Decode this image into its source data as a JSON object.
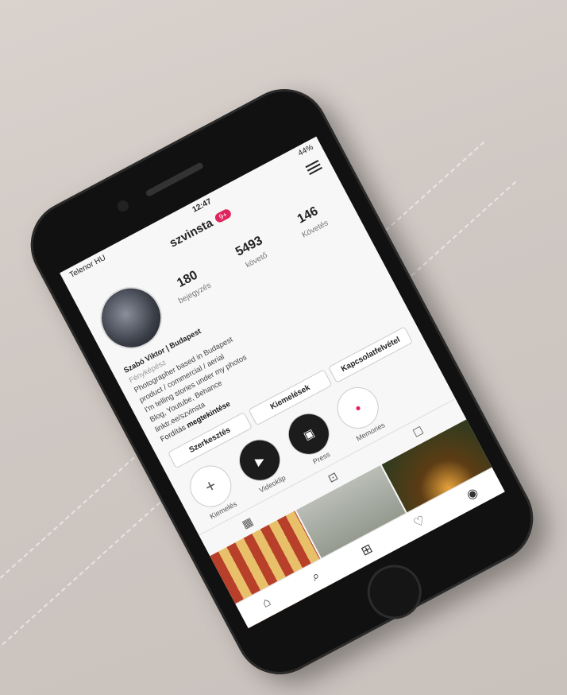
{
  "status": {
    "carrier": "Telenor HU",
    "time": "12:47",
    "battery": "44%"
  },
  "header": {
    "username": "szvinsta",
    "notif_badge": "9+"
  },
  "stats": [
    {
      "number": "180",
      "label": "bejegyzés"
    },
    {
      "number": "5493",
      "label": "követő"
    },
    {
      "number": "146",
      "label": "Követés"
    }
  ],
  "bio": {
    "name": "Szabó Viktor | Budapest",
    "category": "Fényképész",
    "line1": "Photographer based in Budapest",
    "line2": "product / commercial / aerial",
    "line3": "I'm telling stories under my photos",
    "line4": "Blog, Youtube, Behance",
    "line5": "linktr.ee/szvinsta",
    "link_prefix": "Fordítás",
    "link_bold": "megtekintése"
  },
  "actions": {
    "edit": "Szerkesztés",
    "promote": "Kiemelések",
    "contact": "Kapcsolatfelvétel"
  },
  "highlights": [
    {
      "label": "Kiemelés",
      "icon": "+"
    },
    {
      "label": "Videoklip",
      "icon": "▶"
    },
    {
      "label": "Press",
      "icon": "▣"
    },
    {
      "label": "Memories",
      "icon": "●"
    }
  ],
  "tabs": {
    "grid_icon": "▦",
    "igtv_icon": "⊡",
    "tagged_icon": "☐"
  },
  "nav": {
    "home": "⌂",
    "search": "⌕",
    "add": "⊞",
    "heart": "♡",
    "profile": "◉"
  }
}
